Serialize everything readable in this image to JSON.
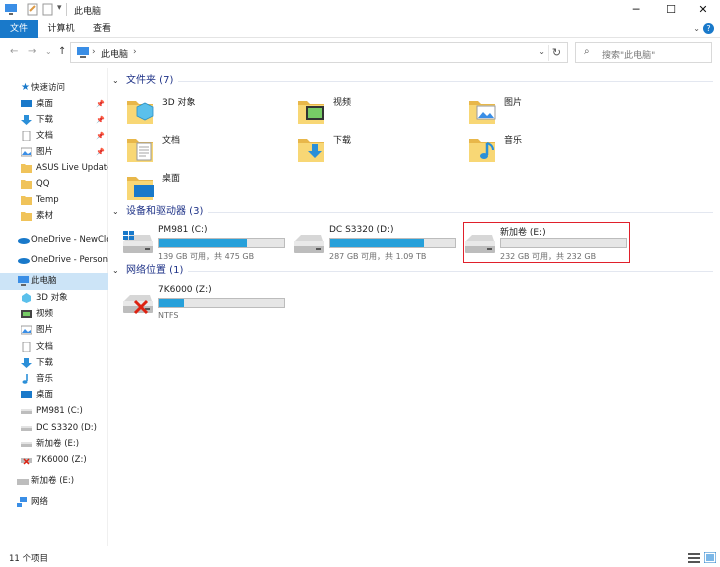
{
  "window": {
    "title": "此电脑"
  },
  "ribbon": {
    "tabs": [
      "文件",
      "计算机",
      "查看"
    ]
  },
  "address": {
    "crumb": "此电脑",
    "sep": "›"
  },
  "search": {
    "placeholder": "搜索\"此电脑\""
  },
  "nav": {
    "quick_access": "快速访问",
    "items": [
      {
        "label": "桌面",
        "icon": "desktop-icon",
        "pinned": true
      },
      {
        "label": "下载",
        "icon": "download-icon",
        "pinned": true
      },
      {
        "label": "文档",
        "icon": "document-icon",
        "pinned": true
      },
      {
        "label": "图片",
        "icon": "picture-icon",
        "pinned": true
      },
      {
        "label": "ASUS Live Update",
        "icon": "folder-icon"
      },
      {
        "label": "QQ",
        "icon": "folder-icon"
      },
      {
        "label": "Temp",
        "icon": "folder-icon"
      },
      {
        "label": "素材",
        "icon": "folder-icon"
      }
    ],
    "onedrive1": "OneDrive - NewClo",
    "onedrive2": "OneDrive - Persona",
    "this_pc": "此电脑",
    "pc_items": [
      {
        "label": "3D 对象",
        "icon": "3d-objects-icon"
      },
      {
        "label": "视频",
        "icon": "video-icon"
      },
      {
        "label": "图片",
        "icon": "picture-icon"
      },
      {
        "label": "文档",
        "icon": "document-icon"
      },
      {
        "label": "下载",
        "icon": "download-icon"
      },
      {
        "label": "音乐",
        "icon": "music-icon"
      },
      {
        "label": "桌面",
        "icon": "desktop-icon"
      },
      {
        "label": "PM981 (C:)",
        "icon": "drive-icon"
      },
      {
        "label": "DC S3320 (D:)",
        "icon": "drive-icon"
      },
      {
        "label": "新加卷 (E:)",
        "icon": "drive-icon"
      },
      {
        "label": "7K6000 (Z:)",
        "icon": "network-drive-icon"
      }
    ],
    "removable": "新加卷 (E:)",
    "network": "网络"
  },
  "content": {
    "folders_header": "文件夹 (7)",
    "folders": [
      {
        "label": "3D 对象",
        "icon": "3d-objects-icon"
      },
      {
        "label": "视频",
        "icon": "video-icon"
      },
      {
        "label": "图片",
        "icon": "picture-icon"
      },
      {
        "label": "文档",
        "icon": "document-icon"
      },
      {
        "label": "下载",
        "icon": "download-icon"
      },
      {
        "label": "音乐",
        "icon": "music-icon"
      },
      {
        "label": "桌面",
        "icon": "desktop-icon"
      }
    ],
    "devices_header": "设备和驱动器 (3)",
    "drives": [
      {
        "name": "PM981 (C:)",
        "info": "139 GB 可用，共 475 GB",
        "used_fraction": 0.707
      },
      {
        "name": "DC S3320 (D:)",
        "info": "287 GB 可用，共 1.09 TB",
        "used_fraction": 0.75
      },
      {
        "name": "新加卷 (E:)",
        "info": "232 GB 可用，共 232 GB",
        "used_fraction": 0.0
      }
    ],
    "network_header": "网络位置 (1)",
    "network_drives": [
      {
        "name": "7K6000 (Z:)",
        "info": "NTFS",
        "used_fraction": 0.2
      }
    ]
  },
  "status": {
    "count": "11 个项目"
  },
  "colors": {
    "accent": "#1979ca",
    "bar_fill": "#26a0da",
    "highlight": "#e0202b",
    "selected": "#cce4f7"
  }
}
